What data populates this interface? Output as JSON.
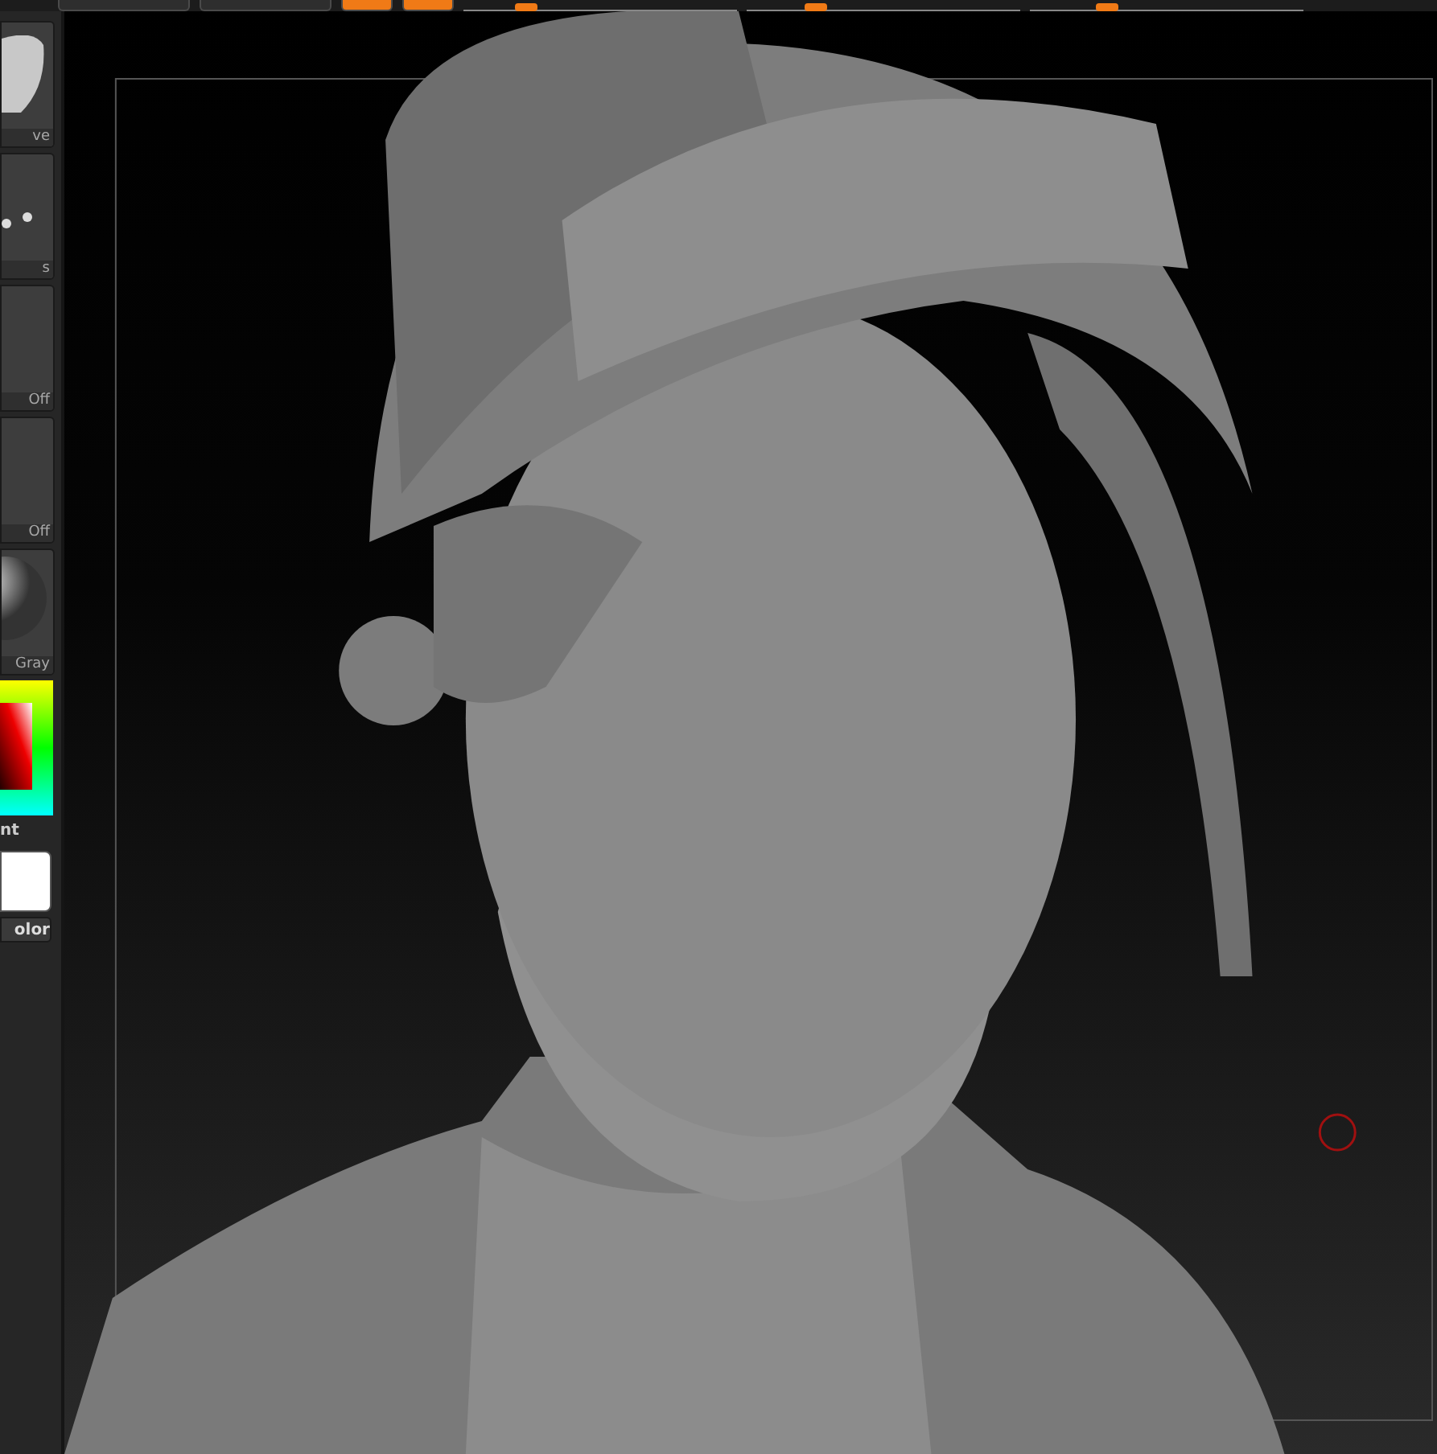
{
  "sidebar": {
    "tiles": [
      {
        "kind": "blob",
        "label": "ve"
      },
      {
        "kind": "dots",
        "label": "s"
      },
      {
        "kind": "blank",
        "label": "Off"
      },
      {
        "kind": "blank",
        "label": "Off"
      },
      {
        "kind": "sphere",
        "label": "Gray"
      }
    ],
    "color_picker": {
      "label": "nt"
    },
    "color_button": "olor"
  },
  "toolbar": {
    "buttons": [
      {
        "active": false
      },
      {
        "active": false
      },
      {
        "active": true
      },
      {
        "active": true
      }
    ],
    "sliders": [
      {
        "level": 0.21
      },
      {
        "level": 0.24
      },
      {
        "level": 0.27
      }
    ]
  }
}
